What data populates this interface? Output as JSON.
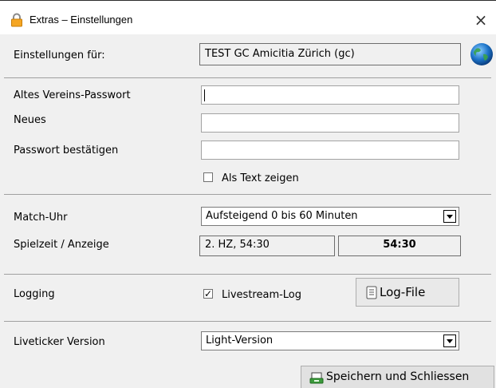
{
  "window": {
    "title": "Extras – Einstellungen",
    "close_label": "×",
    "icons": {
      "title": "lock-icon",
      "close": "close-icon",
      "globe": "globe-icon"
    }
  },
  "club": {
    "label": "Einstellungen für:",
    "value": "TEST GC Amicitia Zürich (gc)"
  },
  "password": {
    "old_label": "Altes Vereins-Passwort",
    "new_label": "Neues",
    "confirm_label": "Passwort bestätigen",
    "old_value": "",
    "new_value": "",
    "confirm_value": "",
    "show_text_label": "Als Text zeigen",
    "show_text_checked": false
  },
  "clock": {
    "match_label": "Match-Uhr",
    "match_value": "Aufsteigend 0 bis 60 Minuten",
    "playtime_label": "Spielzeit / Anzeige",
    "playtime_value": "2. HZ, 54:30",
    "display_value": "54:30"
  },
  "logging": {
    "label": "Logging",
    "livestream_label": "Livestream-Log",
    "livestream_checked": true,
    "logfile_button": "Log-File",
    "logfile_icon": "document-icon"
  },
  "liveticker": {
    "label": "Liveticker Version",
    "value": "Light-Version"
  },
  "footer": {
    "save_button": "Speichern und Schliessen",
    "save_icon": "save-icon"
  },
  "colors": {
    "window_bg": "#f0f0f0",
    "titlebar_bg": "#ffffff",
    "lock_body": "#f5a623",
    "globe": "#1d74c9"
  }
}
